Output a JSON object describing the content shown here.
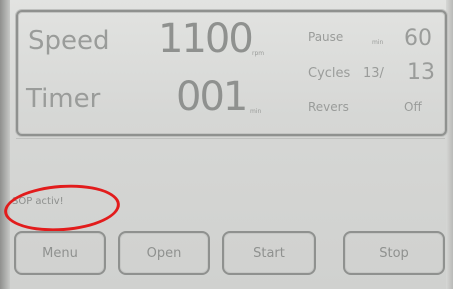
{
  "display": {
    "speed": {
      "label": "Speed",
      "value": "1100",
      "unit": "rpm"
    },
    "timer": {
      "label": "Timer",
      "value": "001",
      "unit": "min"
    },
    "pause": {
      "label": "Pause",
      "unit": "min",
      "value": "60"
    },
    "cycles": {
      "label": "Cycles",
      "current": "13/",
      "total": "13"
    },
    "revers": {
      "label": "Revers",
      "value": "Off"
    }
  },
  "status": {
    "message": "SOP activ!"
  },
  "buttons": {
    "menu": "Menu",
    "open": "Open",
    "start": "Start",
    "stop": "Stop"
  },
  "annotation": {
    "highlight_color": "#e21c1c"
  }
}
